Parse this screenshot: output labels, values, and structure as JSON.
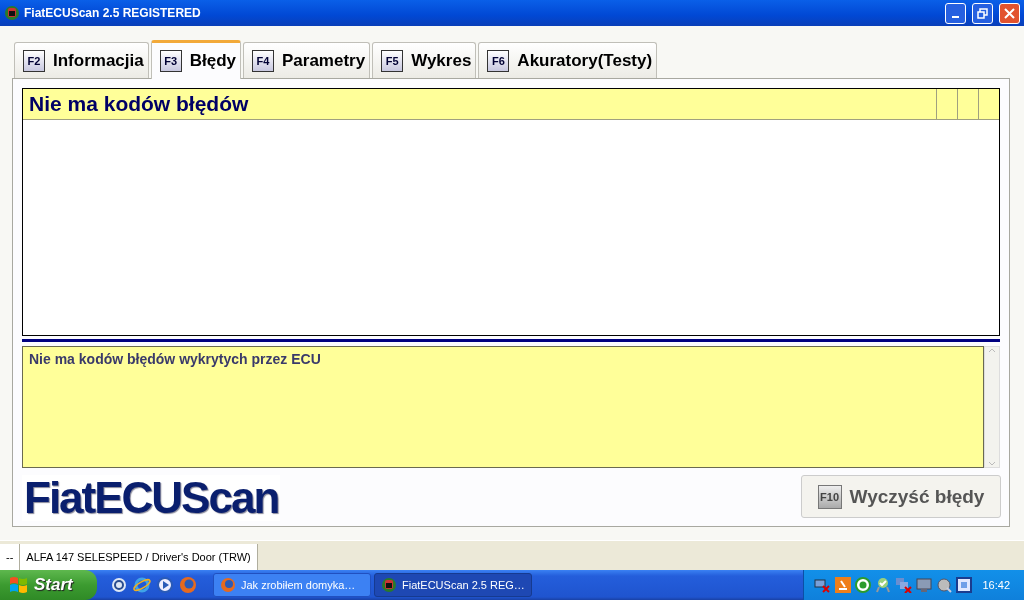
{
  "window": {
    "title": "FiatECUScan 2.5 REGISTERED"
  },
  "tabs": [
    {
      "key": "F2",
      "label": "Informacjia",
      "selected": false
    },
    {
      "key": "F3",
      "label": "Błędy",
      "selected": true
    },
    {
      "key": "F4",
      "label": "Parametry",
      "selected": false
    },
    {
      "key": "F5",
      "label": "Wykres",
      "selected": false
    },
    {
      "key": "F6",
      "label": "Akuratory(Testy)",
      "selected": false
    }
  ],
  "error_table": {
    "header": "Nie ma kodów błędów"
  },
  "message": {
    "text": "Nie ma kodów błędów wykrytych przez ECU"
  },
  "logo": "FiatECUScan",
  "clear_button": {
    "key": "F10",
    "label": "Wyczyść błędy",
    "disabled": true
  },
  "status_bar": [
    "--",
    "ALFA 147 SELESPEED / Driver's Door (TRW)"
  ],
  "taskbar": {
    "start": "Start",
    "tasks": [
      {
        "label": "Jak zrobiłem domyka…",
        "selected": false
      },
      {
        "label": "FiatECUScan 2.5 REG…",
        "selected": true
      }
    ],
    "clock": "16:42"
  }
}
